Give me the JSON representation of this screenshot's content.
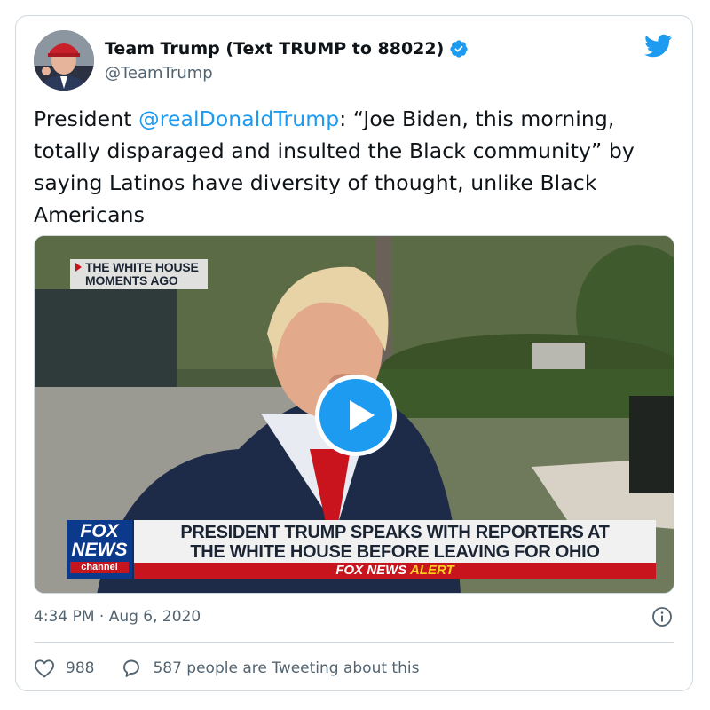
{
  "tweet": {
    "display_name": "Team Trump (Text TRUMP to 88022)",
    "handle": "@TeamTrump",
    "text_prefix": "President ",
    "mention": "@realDonaldTrump",
    "text_suffix": ": “Joe Biden, this morning, totally disparaged and insulted the Black community” by saying Latinos have diversity of thought, unlike Black Americans",
    "timestamp": "4:34 PM · Aug 6, 2020",
    "like_count": "988",
    "conversation_label": "587 people are Tweeting about this"
  },
  "video": {
    "badge_line1": "THE WHITE HOUSE",
    "badge_line2": "MOMENTS AGO",
    "logo_fox": "FOX",
    "logo_news": "NEWS",
    "logo_channel": "channel",
    "chyron_line1": "PRESIDENT TRUMP SPEAKS WITH REPORTERS AT",
    "chyron_line2": "THE WHITE HOUSE BEFORE LEAVING FOR OHIO",
    "alert_brand": "FOX NEWS",
    "alert_word": "ALERT"
  },
  "icons": {
    "verified": "verified-badge-icon",
    "brand": "twitter-bird-icon",
    "play": "play-icon",
    "info": "info-icon",
    "like": "heart-icon",
    "reply": "speech-bubble-icon"
  },
  "colors": {
    "accent": "#1d9bf0",
    "text": "#0f1419",
    "muted": "#536471",
    "border": "#cfd9de",
    "fox_blue": "#0b3a8c",
    "fox_red": "#c8141d"
  }
}
